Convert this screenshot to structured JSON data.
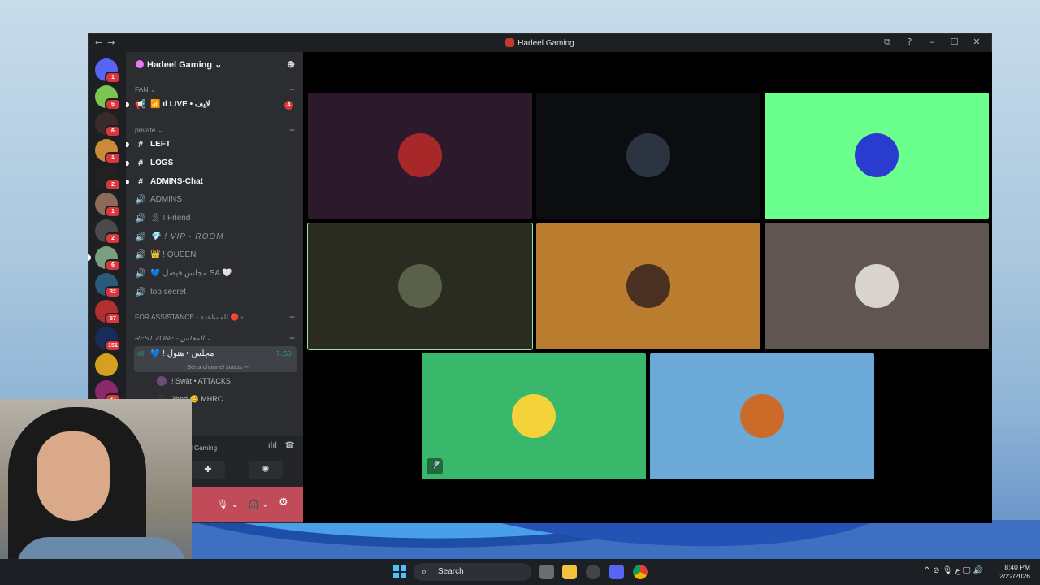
{
  "window": {
    "title": "Hadeel Gaming",
    "back": "←",
    "forward": "→"
  },
  "title_icons": {
    "inbox": "⧉",
    "help": "?",
    "minimize": "–",
    "maximize": "☐",
    "close": "✕"
  },
  "servers": [
    {
      "badge": "1",
      "color": "#5865f2",
      "icon": "discord-logo"
    },
    {
      "badge": "6",
      "color": "#7ac74f"
    },
    {
      "badge": "6",
      "color": "#3a2b2b"
    },
    {
      "badge": "1",
      "color": "#c98a3a"
    },
    {
      "badge": "2",
      "color": "#222222"
    },
    {
      "badge": "1",
      "color": "#8a6b5a"
    },
    {
      "badge": "2",
      "color": "#4a4a4a"
    },
    {
      "badge": "6",
      "color": "#7a9e7e",
      "selected": true
    },
    {
      "badge": "32",
      "color": "#2b5a7a"
    },
    {
      "badge": "57",
      "color": "#b03030"
    },
    {
      "badge": "151",
      "color": "#182c5a"
    },
    {
      "badge": "",
      "color": "#d4a020"
    },
    {
      "badge": "37",
      "color": "#8a2a6a"
    }
  ],
  "guild": {
    "name": "Hadeel Gaming ⌄",
    "add_user_icon": "person-add-icon"
  },
  "categories": {
    "fan": "FAN ⌄",
    "private": "private ⌄",
    "assistance": "FOR ASSISTANCE - للمساعدة 🔴 ›",
    "rest": "REST ZONE - المجلس ⌄",
    "plus": "+"
  },
  "channels": {
    "live": {
      "icon": "📢",
      "label": "📶 ıl LIVE • لايف",
      "badge": "4"
    },
    "left": {
      "icon": "#",
      "label": "LEFT"
    },
    "logs": {
      "icon": "#",
      "label": "LOGS"
    },
    "admins_chat": {
      "icon": "#",
      "label": "ADMINS-Chat"
    },
    "admins": {
      "icon": "🔊",
      "label": "ADMINS"
    },
    "friend": {
      "icon": "🔊",
      "label": "🎗 ! Friend"
    },
    "vip": {
      "icon": "🔊",
      "label": "💎 ! VIP · ROOM"
    },
    "queen": {
      "icon": "🔊",
      "label": "👑 ! QUEEN"
    },
    "majlis_faisal": {
      "icon": "🔊",
      "label": "💙 مجلس فيصل SA 🤍"
    },
    "top_secret": {
      "icon": "🔊",
      "label": "top secret"
    },
    "majlis_hanol": {
      "icon": "ılıl",
      "label": "💙 ! مجلس • هنول",
      "time": "7:53"
    }
  },
  "channel_status": "Set a channel status ✏",
  "members": [
    {
      "name": "! Swàt • ATTACKS"
    },
    {
      "name": "3bod 😊 MHRC"
    }
  ],
  "voice_panel": {
    "connected_to": "l Gaming",
    "activity_icon": "activities-icon",
    "soundboard_icon": "soundboard-icon",
    "signal": "ılıl",
    "disconnect": "☎"
  },
  "user_bar": {
    "mic": "🎙 ⌄",
    "headphones": "🎧 ⌄",
    "settings": "⚙"
  },
  "tiles": [
    {
      "bg": "#2c1a2c",
      "avatar": "#a8282a"
    },
    {
      "bg": "#0c0d10",
      "avatar": "#2b3440"
    },
    {
      "bg": "#6bff8e",
      "avatar": "#2a3ccf"
    },
    {
      "bg": "#2a2b21",
      "avatar": "#59614a",
      "speaking": true
    },
    {
      "bg": "#ba7d30",
      "avatar": "#4a3020"
    },
    {
      "bg": "#605551",
      "avatar": "#d9d4d0"
    },
    {
      "bg": "#39b86b",
      "avatar": "#f3d23a",
      "muted": true
    },
    {
      "bg": "#6ba9d8",
      "avatar": "#cc6a2a"
    }
  ],
  "mute_icon": "🎤̸",
  "taskbar": {
    "search": "Search",
    "search_icon": "⌕",
    "tray": "^  ⊘  🎙  ع  🖵  🔊",
    "time": "8:40 PM",
    "date": "2/22/2026"
  }
}
